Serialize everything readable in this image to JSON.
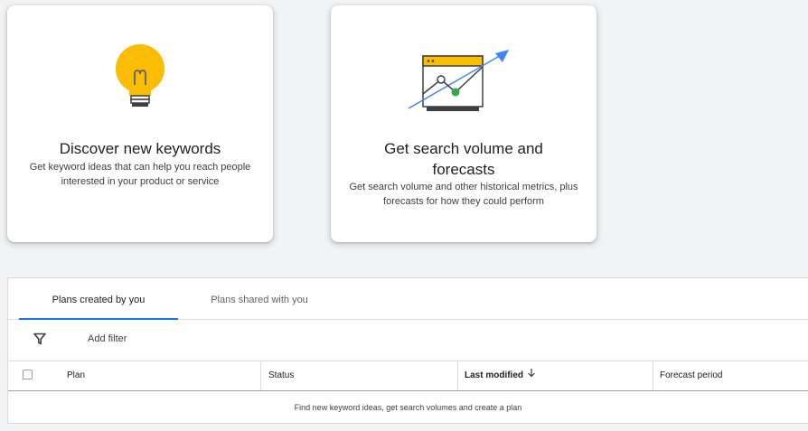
{
  "cards": {
    "discover": {
      "title": "Discover new keywords",
      "description": "Get keyword ideas that can help you reach people interested in your product or service",
      "icon": "lightbulb-icon"
    },
    "forecast": {
      "title": "Get search volume and forecasts",
      "description": "Get search volume and other historical metrics, plus forecasts for how they could perform",
      "icon": "chart-window-icon"
    }
  },
  "tabs": {
    "mine": "Plans created by you",
    "shared": "Plans shared with you",
    "active": "mine"
  },
  "filter": {
    "icon": "filter-icon",
    "label": "Add filter"
  },
  "table": {
    "columns": {
      "plan": "Plan",
      "status": "Status",
      "last_modified": "Last modified",
      "forecast_period": "Forecast period"
    },
    "sorted_column": "last_modified",
    "sort_direction": "descending",
    "empty_message": "Find new keyword ideas, get search volumes and create a plan"
  },
  "colors": {
    "accent": "#1a73e8",
    "bulb_yellow": "#fbbc04",
    "green_point": "#34a853",
    "arrow_blue": "#4285f4"
  }
}
